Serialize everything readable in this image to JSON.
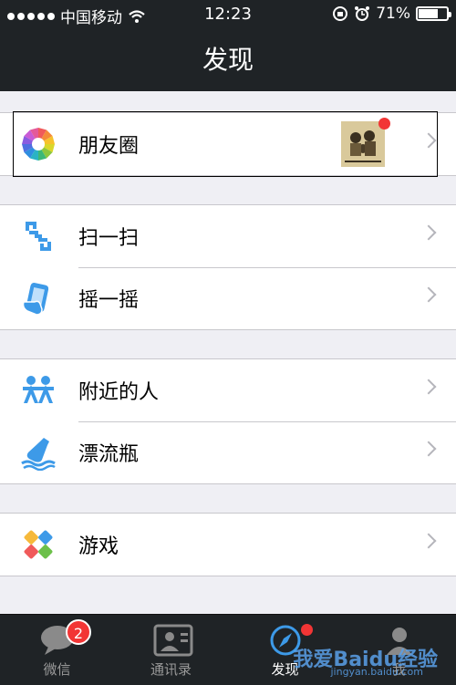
{
  "status": {
    "carrier": "中国移动",
    "time": "12:23",
    "battery": "71%",
    "battery_level": 0.71
  },
  "nav": {
    "title": "发现"
  },
  "groups": [
    {
      "items": [
        {
          "label": "朋友圈",
          "icon": "moments-shutter-icon"
        }
      ]
    },
    {
      "items": [
        {
          "label": "扫一扫",
          "icon": "scan-icon"
        },
        {
          "label": "摇一摇",
          "icon": "shake-phone-icon"
        }
      ]
    },
    {
      "items": [
        {
          "label": "附近的人",
          "icon": "people-nearby-icon"
        },
        {
          "label": "漂流瓶",
          "icon": "drift-bottle-icon"
        }
      ]
    },
    {
      "items": [
        {
          "label": "游戏",
          "icon": "game-icon"
        }
      ]
    }
  ],
  "tabs": [
    {
      "label": "微信",
      "badge": "2",
      "icon": "chat-bubble-icon"
    },
    {
      "label": "通讯录",
      "icon": "contacts-card-icon"
    },
    {
      "label": "发现",
      "icon": "compass-icon",
      "active": true
    },
    {
      "label": "我",
      "icon": "person-icon"
    }
  ],
  "watermark": {
    "line1": "我爱Baidu经验",
    "line2": "jingyan.baidu.com"
  }
}
